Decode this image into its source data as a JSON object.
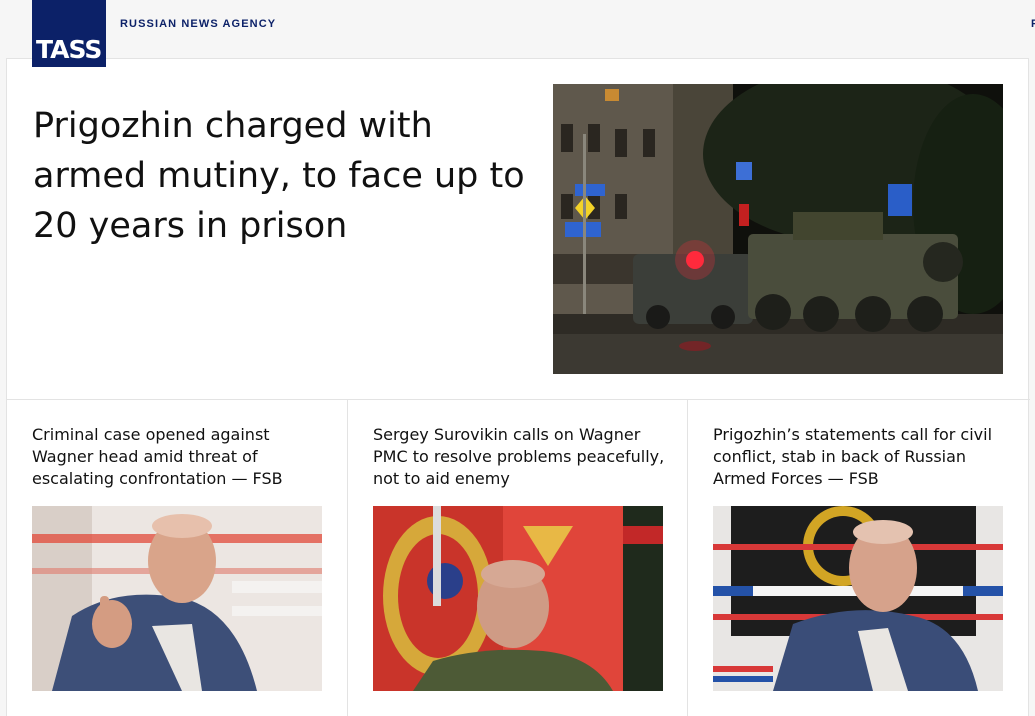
{
  "header": {
    "logo_text": "TASS",
    "tagline": "RUSSIAN NEWS AGENCY",
    "edge_letter": "F"
  },
  "hero": {
    "title": "Prigozhin charged with armed mutiny, to face up to 20 years in prison"
  },
  "cards": [
    {
      "title": "Criminal case opened against Wagner head amid threat of escalating confrontation — FSB"
    },
    {
      "title": "Sergey Surovikin calls on Wagner PMC to resolve problems peacefully, not to aid enemy"
    },
    {
      "title": "Prigozhin’s statements call for civil conflict, stab in back of Russian Armed Forces — FSB"
    }
  ],
  "colors": {
    "brand": "#0c2168",
    "background": "#f6f6f6"
  }
}
